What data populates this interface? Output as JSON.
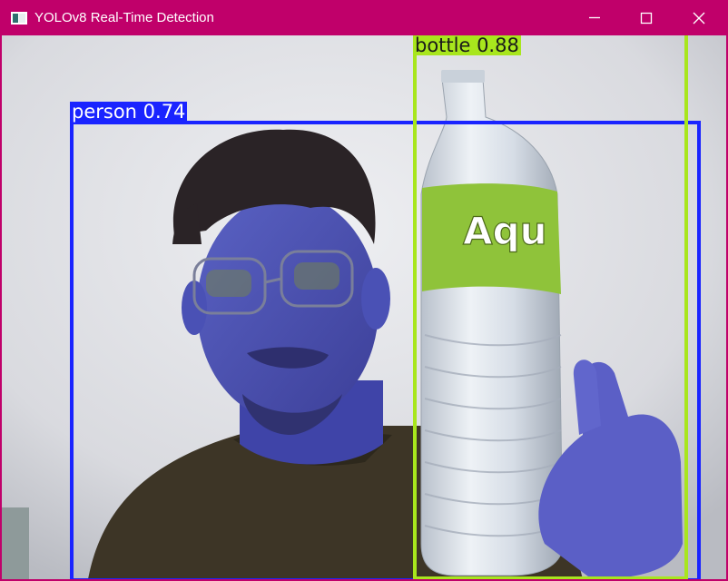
{
  "window": {
    "title": "YOLOv8 Real-Time Detection",
    "colors": {
      "titlebar": "#c0006a",
      "title_text": "#ffffff"
    },
    "controls": {
      "minimize_icon": "minimize-icon",
      "maximize_icon": "maximize-icon",
      "close_icon": "close-icon"
    }
  },
  "detections": [
    {
      "label_text": "person 0.74",
      "class": "person",
      "confidence": 0.74,
      "color": "#1a24ff",
      "label_text_color": "#ffffff"
    },
    {
      "label_text": "bottle 0.88",
      "class": "bottle",
      "confidence": 0.88,
      "color": "#a8e61d",
      "label_text_color": "#1a1a1a"
    }
  ],
  "bottle_brand": "Aqu"
}
